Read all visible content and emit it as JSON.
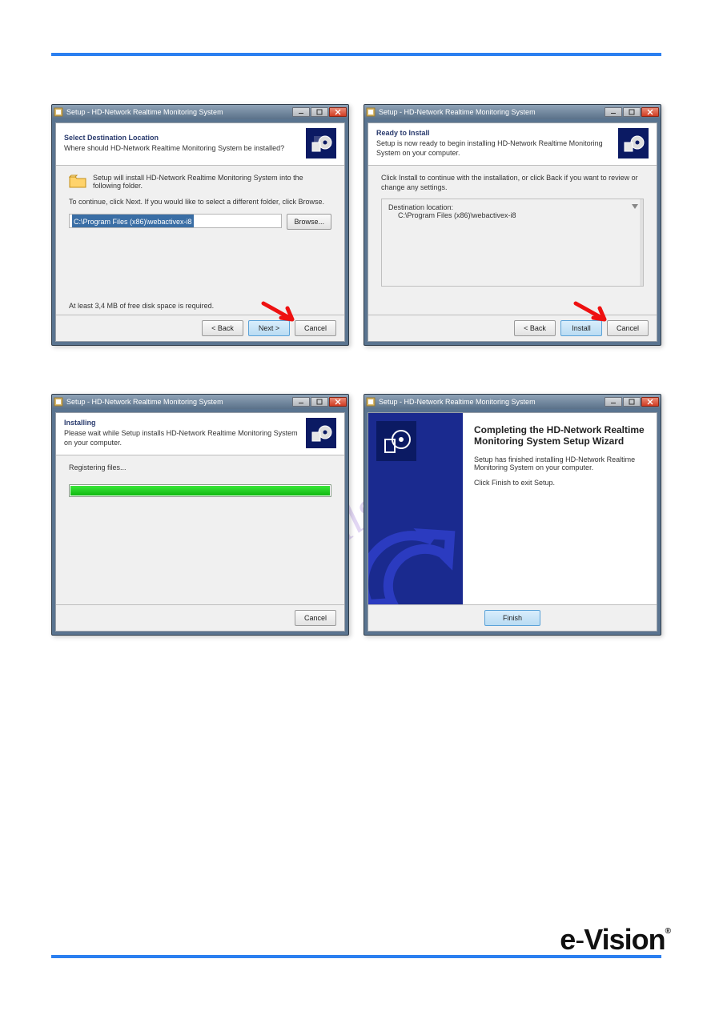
{
  "common": {
    "window_title": "Setup - HD-Network Realtime Monitoring System"
  },
  "dialog1": {
    "heading": "Select Destination Location",
    "sub": "Where should HD-Network Realtime Monitoring System be installed?",
    "folder_text": "Setup will install HD-Network Realtime Monitoring System into the following folder.",
    "continue_text": "To continue, click Next. If you would like to select a different folder, click Browse.",
    "path": "C:\\Program Files (x86)\\webactivex-i8",
    "browse": "Browse...",
    "disk_note": "At least 3,4 MB of free disk space is required.",
    "back": "< Back",
    "next": "Next >",
    "cancel": "Cancel"
  },
  "dialog2": {
    "heading": "Ready to Install",
    "sub": "Setup is now ready to begin installing HD-Network Realtime Monitoring System on your computer.",
    "review": "Click Install to continue with the installation, or click Back if you want to review or change any settings.",
    "dest_label": "Destination location:",
    "dest_value": "C:\\Program Files (x86)\\webactivex-i8",
    "back": "< Back",
    "install": "Install",
    "cancel": "Cancel"
  },
  "dialog3": {
    "heading": "Installing",
    "sub": "Please wait while Setup installs HD-Network Realtime Monitoring System on your computer.",
    "status": "Registering files...",
    "cancel": "Cancel"
  },
  "dialog4": {
    "heading": "Completing the HD-Network Realtime Monitoring System Setup Wizard",
    "body1": "Setup has finished installing HD-Network Realtime Monitoring System on your computer.",
    "body2": "Click Finish to exit Setup.",
    "finish": "Finish"
  },
  "watermark": "manualslib.com",
  "brand": {
    "label": "e-Vision"
  }
}
